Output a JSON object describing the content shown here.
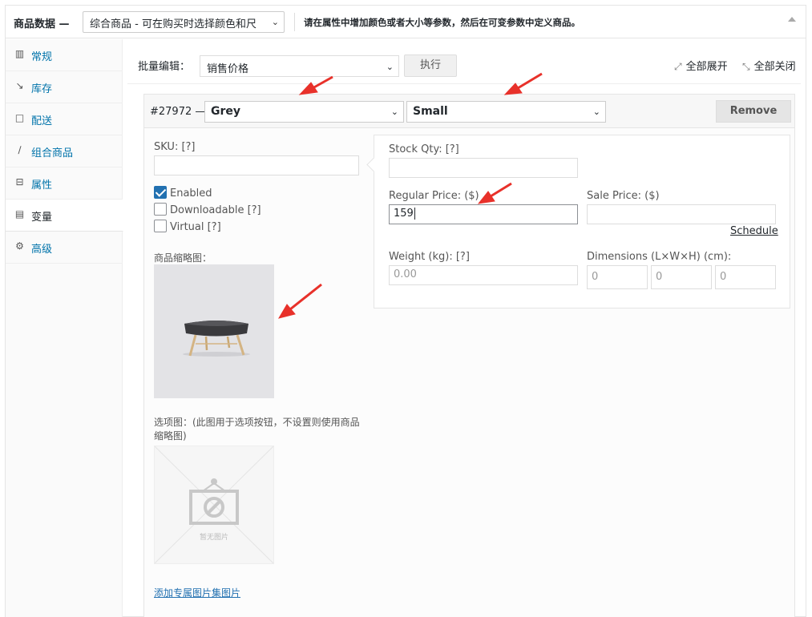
{
  "header": {
    "title": "商品数据 —",
    "product_type": "综合商品 - 可在购买时选择颜色和尺",
    "description": "请在属性中增加颜色或者大小等参数，然后在可变参数中定义商品。"
  },
  "sidebar": {
    "items": [
      {
        "label": "常规",
        "icon": "grid-icon"
      },
      {
        "label": "库存",
        "icon": "chart-icon"
      },
      {
        "label": "配送",
        "icon": "truck-icon"
      },
      {
        "label": "组合商品",
        "icon": "link-icon"
      },
      {
        "label": "属性",
        "icon": "list-icon"
      },
      {
        "label": "变量",
        "icon": "window-icon"
      },
      {
        "label": "高级",
        "icon": "gear-icon"
      }
    ],
    "active_index": 5
  },
  "toolbar": {
    "bulk_label": "批量编辑：",
    "bulk_value": "销售价格",
    "go_label": "执行",
    "expand_label": "全部展开",
    "collapse_label": "全部关闭"
  },
  "variation": {
    "id": "#27972 —",
    "color": "Grey",
    "size": "Small",
    "remove_label": "Remove",
    "sku_label": "SKU: [?]",
    "sku_value": "",
    "enabled_label": "Enabled",
    "downloadable_label": "Downloadable [?]",
    "virtual_label": "Virtual [?]",
    "thumb_label": "商品缩略图：",
    "option_image_label": "选项图：(此图用于选项按钮，不设置则使用商品缩略图)",
    "placeholder_text": "暂无图片",
    "add_gallery_label": "添加专属图片集图片",
    "stock_label": "Stock Qty: [?]",
    "stock_value": "",
    "regular_price_label": "Regular Price: ($)",
    "regular_price_value": "159",
    "sale_price_label": "Sale Price: ($)",
    "sale_price_value": "",
    "schedule_label": "Schedule",
    "weight_label": "Weight (kg): [?]",
    "weight_placeholder": "0.00",
    "dimensions_label": "Dimensions (L×W×H) (cm):",
    "dim_length": "0",
    "dim_width": "0",
    "dim_height": "0"
  },
  "colors": {
    "link": "#2271b1",
    "arrow": "#e8312a",
    "checkbox": "#2271b1"
  }
}
